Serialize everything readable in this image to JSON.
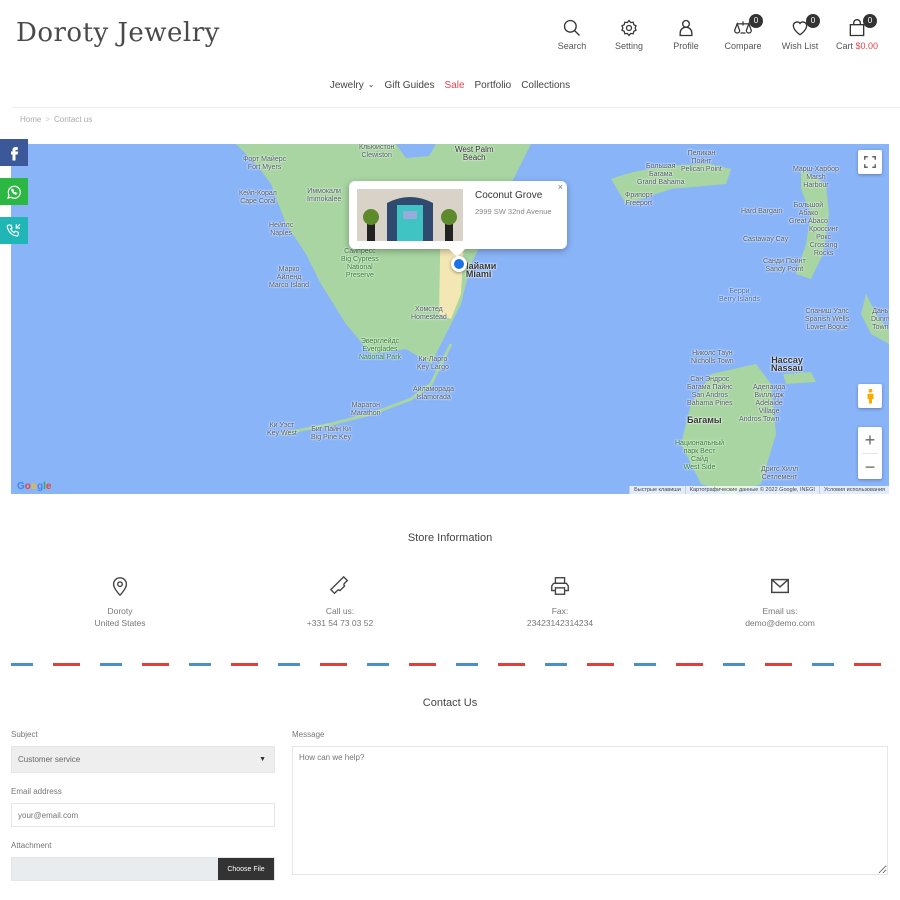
{
  "header": {
    "logo": "Doroty Jewelry",
    "tools": [
      {
        "icon": "search-icon",
        "label": "Search"
      },
      {
        "icon": "gear-icon",
        "label": "Setting"
      },
      {
        "icon": "user-icon",
        "label": "Profile"
      },
      {
        "icon": "scales-icon",
        "label": "Compare",
        "badge": "0"
      },
      {
        "icon": "heart-icon",
        "label": "Wish List",
        "badge": "0"
      },
      {
        "icon": "bag-icon",
        "label": "Cart",
        "price": "$0.00",
        "badge": "0"
      }
    ]
  },
  "nav": {
    "items": [
      {
        "label": "Jewelry",
        "dropdown": true
      },
      {
        "label": "Gift Guides"
      },
      {
        "label": "Sale",
        "highlight": true
      },
      {
        "label": "Portfolio"
      },
      {
        "label": "Collections"
      }
    ]
  },
  "breadcrumb": [
    "Home",
    "Contact us"
  ],
  "social": [
    {
      "icon": "facebook-icon",
      "color": "#3b5998"
    },
    {
      "icon": "whatsapp-icon",
      "color": "#2bb741"
    },
    {
      "icon": "phone-callback-icon",
      "color": "#1fb6b5"
    }
  ],
  "map": {
    "popup": {
      "title": "Coconut Grove",
      "address": "2999 SW 32nd Avenue",
      "close": "×"
    },
    "labels": {
      "fort_myers": "Форт Майерс\nFort Myers",
      "cape_coral": "Кейп-Корал\nCape Coral",
      "naples": "Нейплс\nNaples",
      "marco": "Марко\nАйленд\nMarco Island",
      "clewiston": "Кльюистон\nClewiston",
      "immokalee": "Иммокали\nImmokalee",
      "west_palm": "West Palm\nBeach",
      "big_cypress": "Сайпресс\nBig Cypress\nNational\nPreserve",
      "miami": "Майами\nMiami",
      "homestead": "Хомстед\nHomestead",
      "everglades": "Эверглейдс\nEverglades\nNational Park",
      "key_largo": "Ки-Ларго\nKey Largo",
      "islamorada": "Айламорада\nIslamorada",
      "marathon": "Маратон\nMarathon",
      "key_west": "Ки Уэст\nKey West",
      "big_pine": "Биг Пайн Ки\nBig Pine Key",
      "grand_bahama": "Большая\nБагама\nGrand Bahama",
      "freeport": "Фрипорт\nFreeport",
      "pelican": "Пеликан\nПойнт\nPelican Point",
      "marsh_harbour": "Марш-Харбор\nMarsh\nHarbour",
      "hard_bargain": "Hard Bargain",
      "great_abaco": "Большой\nАбако\nGreat Abaco",
      "castaway": "Castaway Cay",
      "crossing_rocks": "Кроссинг\nРокс\nCrossing\nRocks",
      "sandy_point": "Санди Пойнт\nSandy Point",
      "berry": "Берри\nBerry Islands",
      "spanish_wells": "Спаниш Уэлс\nSpanish Wells\nLower Bogue",
      "dunmore": "Дань\nDunm\nTown",
      "nicholls": "Николс Таун\nNicholls Town",
      "san_andros": "Сан Эндрос\nБагама Пайнс\nSan Andros\nBahama Pines",
      "nassau": "Нассау\nNassau",
      "adelaide": "Аделаида\nВиллидж\nAdelaide\nVillage",
      "andros_town": "Andros Town",
      "bahamas": "Багамы",
      "west_side": "Национальный\nпарк Вест\nСайд\nWest Side",
      "driggs": "Дригс Хилл\nСетлемент"
    },
    "attribution": [
      "Быстрые клавиши",
      "Картографические данные © 2022 Google, INEGI",
      "Условия использования"
    ],
    "zoom_in": "+",
    "zoom_out": "−"
  },
  "store_info": {
    "title": "Store Information",
    "items": [
      {
        "icon": "location-pin-icon",
        "line1": "Doroty",
        "line2": "United States"
      },
      {
        "icon": "phone-icon",
        "line1": "Call us:",
        "line2": "+331 54 73 03 52"
      },
      {
        "icon": "printer-icon",
        "line1": "Fax:",
        "line2": "23423142314234"
      },
      {
        "icon": "envelope-icon",
        "line1": "Email us:",
        "line2": "demo@demo.com"
      }
    ]
  },
  "contact": {
    "title": "Contact Us",
    "subject_label": "Subject",
    "subject_value": "Customer service",
    "email_label": "Email address",
    "email_placeholder": "your@email.com",
    "attachment_label": "Attachment",
    "choose_file": "Choose File",
    "message_label": "Message",
    "message_placeholder": "How can we help?"
  },
  "colors": {
    "accent": "#e0454e",
    "dash_red": "#e0403a",
    "dash_blue": "#4a90c8",
    "map_water": "#8ab4f8",
    "map_land": "#a8d5a2"
  }
}
